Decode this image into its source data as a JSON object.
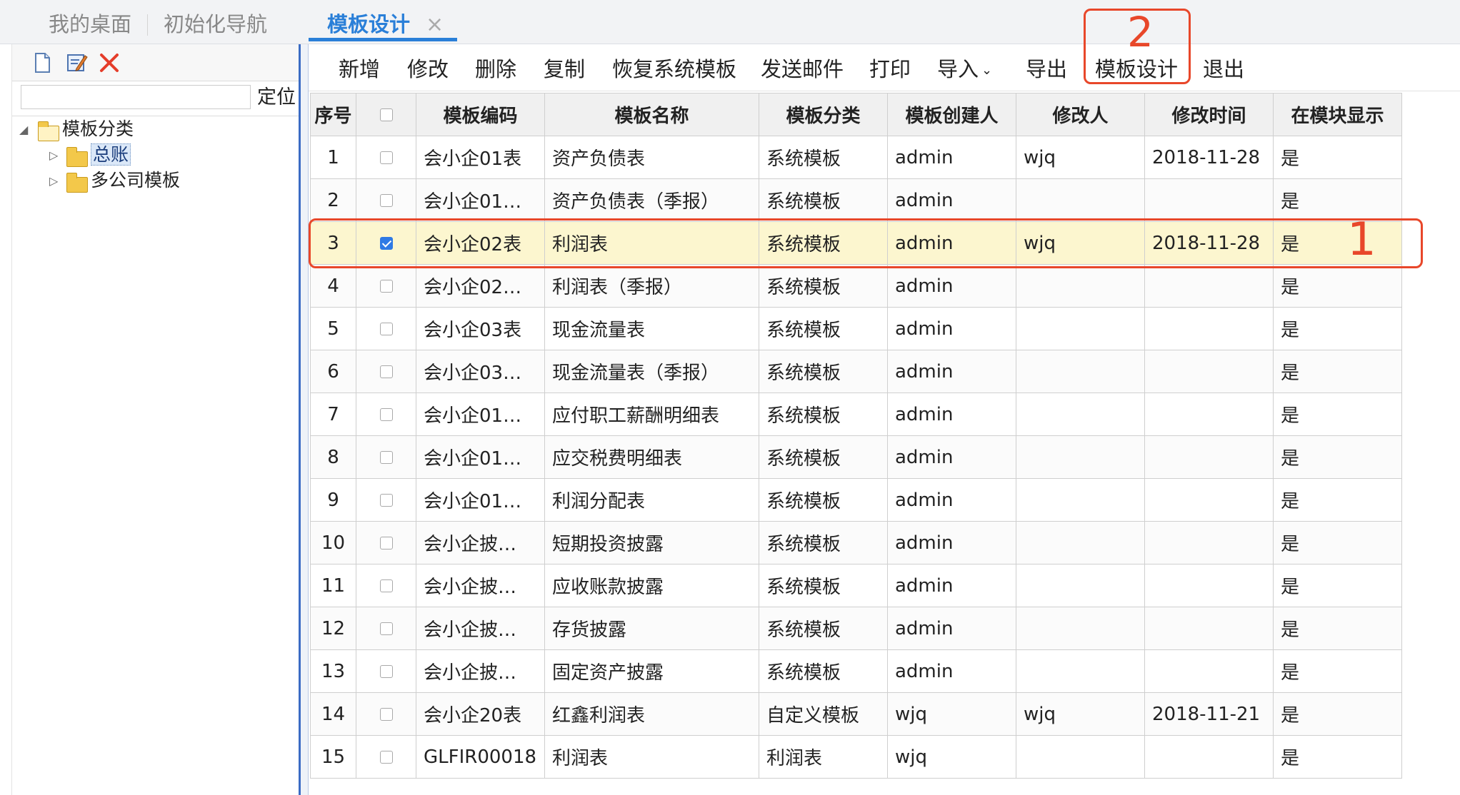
{
  "tabs": {
    "items": [
      "我的桌面",
      "初始化导航"
    ],
    "active": "模板设计",
    "close_glyph": "×"
  },
  "left": {
    "icons": [
      "new-document-icon",
      "edit-icon",
      "delete-icon"
    ],
    "locate_value": "",
    "locate_label": "定位",
    "tree": {
      "root": "模板分类",
      "children": [
        "总账",
        "多公司模板"
      ],
      "selected": "总账"
    }
  },
  "toolbar": {
    "add": "新增",
    "edit": "修改",
    "delete": "删除",
    "copy": "复制",
    "restore": "恢复系统模板",
    "email": "发送邮件",
    "print": "打印",
    "import": "导入",
    "export": "导出",
    "design": "模板设计",
    "exit": "退出"
  },
  "grid": {
    "columns": [
      "序号",
      "",
      "模板编码",
      "模板名称",
      "模板分类",
      "模板创建人",
      "修改人",
      "修改时间",
      "在模块显示"
    ],
    "rows": [
      {
        "no": "1",
        "checked": false,
        "code": "会小企01表",
        "name": "资产负债表",
        "cat": "系统模板",
        "creator": "admin",
        "modifier": "wjq",
        "time": "2018-11-28",
        "show": "是"
      },
      {
        "no": "2",
        "checked": false,
        "code": "会小企01…",
        "name": "资产负债表（季报）",
        "cat": "系统模板",
        "creator": "admin",
        "modifier": "",
        "time": "",
        "show": "是"
      },
      {
        "no": "3",
        "checked": true,
        "code": "会小企02表",
        "name": "利润表",
        "cat": "系统模板",
        "creator": "admin",
        "modifier": "wjq",
        "time": "2018-11-28",
        "show": "是"
      },
      {
        "no": "4",
        "checked": false,
        "code": "会小企02…",
        "name": "利润表（季报）",
        "cat": "系统模板",
        "creator": "admin",
        "modifier": "",
        "time": "",
        "show": "是"
      },
      {
        "no": "5",
        "checked": false,
        "code": "会小企03表",
        "name": "现金流量表",
        "cat": "系统模板",
        "creator": "admin",
        "modifier": "",
        "time": "",
        "show": "是"
      },
      {
        "no": "6",
        "checked": false,
        "code": "会小企03…",
        "name": "现金流量表（季报）",
        "cat": "系统模板",
        "creator": "admin",
        "modifier": "",
        "time": "",
        "show": "是"
      },
      {
        "no": "7",
        "checked": false,
        "code": "会小企01…",
        "name": "应付职工薪酬明细表",
        "cat": "系统模板",
        "creator": "admin",
        "modifier": "",
        "time": "",
        "show": "是"
      },
      {
        "no": "8",
        "checked": false,
        "code": "会小企01…",
        "name": "应交税费明细表",
        "cat": "系统模板",
        "creator": "admin",
        "modifier": "",
        "time": "",
        "show": "是"
      },
      {
        "no": "9",
        "checked": false,
        "code": "会小企01…",
        "name": "利润分配表",
        "cat": "系统模板",
        "creator": "admin",
        "modifier": "",
        "time": "",
        "show": "是"
      },
      {
        "no": "10",
        "checked": false,
        "code": "会小企披…",
        "name": "短期投资披露",
        "cat": "系统模板",
        "creator": "admin",
        "modifier": "",
        "time": "",
        "show": "是"
      },
      {
        "no": "11",
        "checked": false,
        "code": "会小企披…",
        "name": "应收账款披露",
        "cat": "系统模板",
        "creator": "admin",
        "modifier": "",
        "time": "",
        "show": "是"
      },
      {
        "no": "12",
        "checked": false,
        "code": "会小企披…",
        "name": "存货披露",
        "cat": "系统模板",
        "creator": "admin",
        "modifier": "",
        "time": "",
        "show": "是"
      },
      {
        "no": "13",
        "checked": false,
        "code": "会小企披…",
        "name": "固定资产披露",
        "cat": "系统模板",
        "creator": "admin",
        "modifier": "",
        "time": "",
        "show": "是"
      },
      {
        "no": "14",
        "checked": false,
        "code": "会小企20表",
        "name": "红鑫利润表",
        "cat": "自定义模板",
        "creator": "wjq",
        "modifier": "wjq",
        "time": "2018-11-21",
        "show": "是"
      },
      {
        "no": "15",
        "checked": false,
        "code": "GLFIR00018",
        "name": "利润表",
        "cat": "利润表",
        "creator": "wjq",
        "modifier": "",
        "time": "",
        "show": "是"
      }
    ]
  },
  "annotations": {
    "row_marker": "1",
    "button_marker": "2",
    "color": "#e8472a"
  },
  "colors": {
    "accent": "#2a7fd8",
    "selected_row": "#fcf6cf",
    "checkbox_checked": "#2f7ae5"
  }
}
